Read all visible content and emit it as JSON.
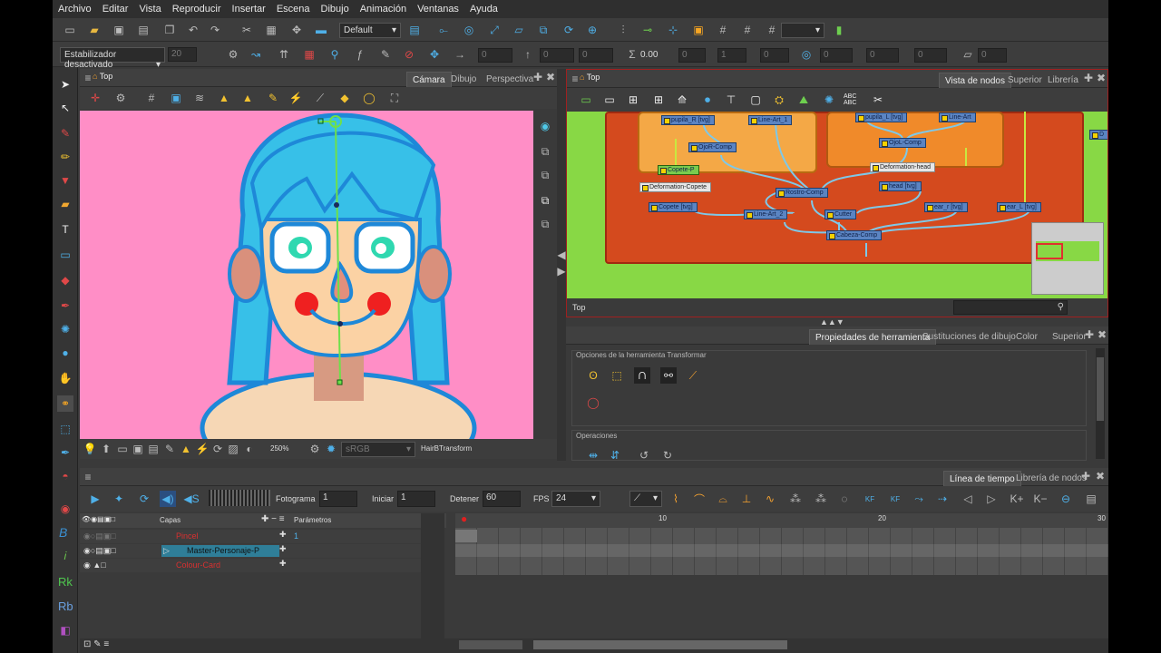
{
  "menu": [
    "Archivo",
    "Editar",
    "Vista",
    "Reproducir",
    "Insertar",
    "Escena",
    "Dibujo",
    "Animación",
    "Ventanas",
    "Ayuda"
  ],
  "toolbar": {
    "workspace": "Default",
    "stabilizer": "Estabilizador desactivado",
    "stab_value": "20",
    "zero": "0",
    "zero_dec": "0.00",
    "one": "1"
  },
  "camera_panel": {
    "breadcrumb": "Top",
    "tabs": [
      "Cámara",
      "Dibujo",
      "Perspectiva"
    ],
    "zoom": "250%",
    "colorspace": "sRGB",
    "status": "HairBTransform"
  },
  "node_panel": {
    "breadcrumb": "Top",
    "tabs": [
      "Vista de nodos",
      "Superior",
      "Librería"
    ],
    "path": "Top",
    "abc_icon": "ABC ABC",
    "nodes": {
      "pupila_r": "pupila_R [tvg]",
      "line_art_1": "Line-Art_1",
      "pupila_l": "pupila_L [tvg]",
      "line_art": "Line-Art",
      "ojor_comp": "OjoR-Comp",
      "ojol_comp": "OjoL-Comp",
      "copete_p": "Copete-P",
      "deformation_head": "Deformation-head",
      "deformation_copete": "Deformation-Copete",
      "rostro_comp": "Rostro-Comp",
      "head": "head [tvg]",
      "copete": "Copete [tvg]",
      "line_art_2": "Line-Art_2",
      "cutter": "Cutter",
      "ear_r": "ear_r [tvg]",
      "ear_l": "ear_L [tvg]",
      "cabeza_comp": "Cabeza-Comp",
      "d": "D"
    }
  },
  "props_panel": {
    "tabs": [
      "Propiedades de herramienta",
      "Sustituciones de dibujo",
      "Color",
      "Superior"
    ],
    "section1": "Opciones de la herramienta Transformar",
    "section2": "Operaciones"
  },
  "timeline": {
    "tabs": [
      "Línea de tiempo",
      "Librería de nodos"
    ],
    "frame_label": "Fotograma",
    "frame": "1",
    "start_label": "Iniciar",
    "start": "1",
    "stop_label": "Detener",
    "stop": "60",
    "fps_label": "FPS",
    "fps": "24",
    "layers_header": "Capas",
    "params_header": "Parámetros",
    "ruler": [
      "10",
      "20",
      "30"
    ],
    "kf": "KF",
    "layers": [
      {
        "name": "Pincel",
        "value": "1"
      },
      {
        "name": "Master-Personaje-P",
        "value": ""
      },
      {
        "name": "Colour-Card",
        "value": ""
      }
    ]
  },
  "side_letters": [
    "B",
    "Rk",
    "Rb"
  ],
  "colors": {
    "bg_pink": "#ff8ec6",
    "hair": "#37c0e8",
    "skin": "#fbd2a4",
    "selection": "#f7a623"
  }
}
